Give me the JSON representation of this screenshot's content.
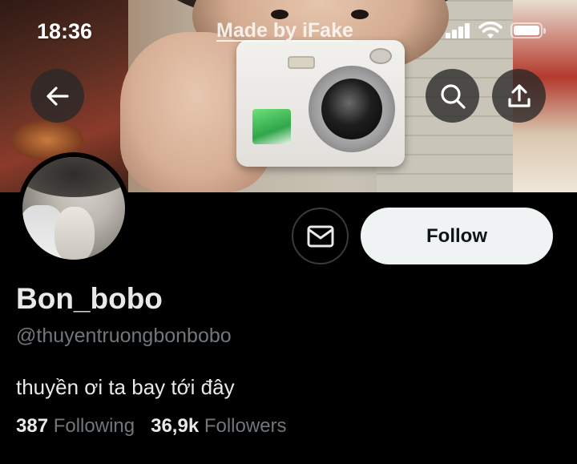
{
  "status_bar": {
    "time": "18:36",
    "watermark": "Made by iFake",
    "icons": [
      "cellular-signal-icon",
      "wifi-icon",
      "battery-icon"
    ]
  },
  "header": {
    "back_icon": "arrow-left-icon",
    "search_icon": "search-icon",
    "share_icon": "share-upload-icon"
  },
  "profile": {
    "display_name": "Bon_bobo",
    "handle": "@thuyentruongbonbobo",
    "bio": "thuyền ơi ta bay tới đây",
    "following_count": "387",
    "following_label": "Following",
    "followers_count": "36,9k",
    "followers_label": "Followers"
  },
  "actions": {
    "message_icon": "envelope-icon",
    "follow_label": "Follow"
  },
  "colors": {
    "background": "#000000",
    "primary_text": "#e7e9ea",
    "secondary_text": "#71767b",
    "follow_button_bg": "#eff3f4",
    "follow_button_text": "#0f1419"
  }
}
